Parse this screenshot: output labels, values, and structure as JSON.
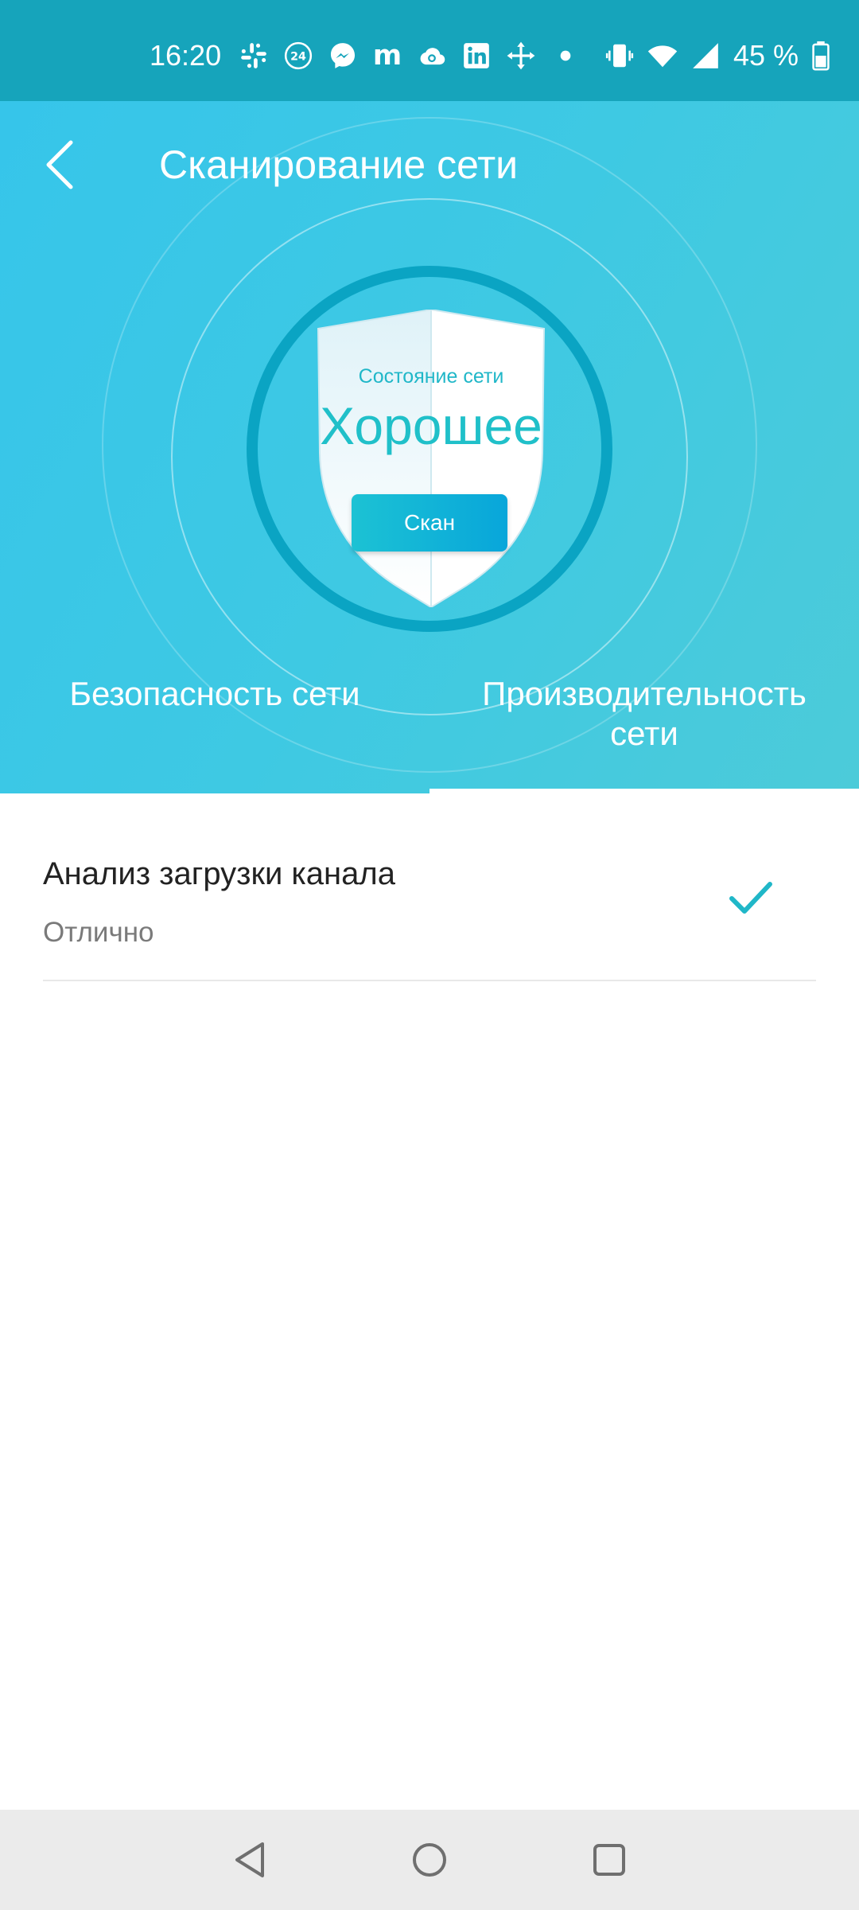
{
  "status_bar": {
    "time": "16:20",
    "notification_icons": [
      "slack-icon",
      "news-24-icon",
      "messenger-icon",
      "m-app-icon",
      "cloud-icon",
      "linkedin-icon",
      "move-icon",
      "dot-icon"
    ],
    "system_icons": [
      "vibrate-icon",
      "wifi-icon",
      "signal-icon",
      "battery-icon"
    ],
    "battery": "45 %"
  },
  "header": {
    "title": "Сканирование сети",
    "back_icon": "chevron-left-icon"
  },
  "shield": {
    "subtitle": "Состояние сети",
    "value": "Хорошее",
    "scan_label": "Скан"
  },
  "tabs": [
    {
      "label": "Безопасность сети",
      "selected": false
    },
    {
      "label": "Производительность сети",
      "selected": true
    }
  ],
  "items": [
    {
      "title": "Анализ загрузки канала",
      "status": "Отлично",
      "icon": "check-icon"
    }
  ],
  "nav": {
    "back": "nav-back-icon",
    "home": "nav-home-icon",
    "recents": "nav-recents-icon"
  },
  "colors": {
    "status_bar": "#16a4bb",
    "header_start": "#36c5ea",
    "header_end": "#4ccbd9",
    "ring": "#0aa4c3",
    "accent": "#20c0c9"
  }
}
